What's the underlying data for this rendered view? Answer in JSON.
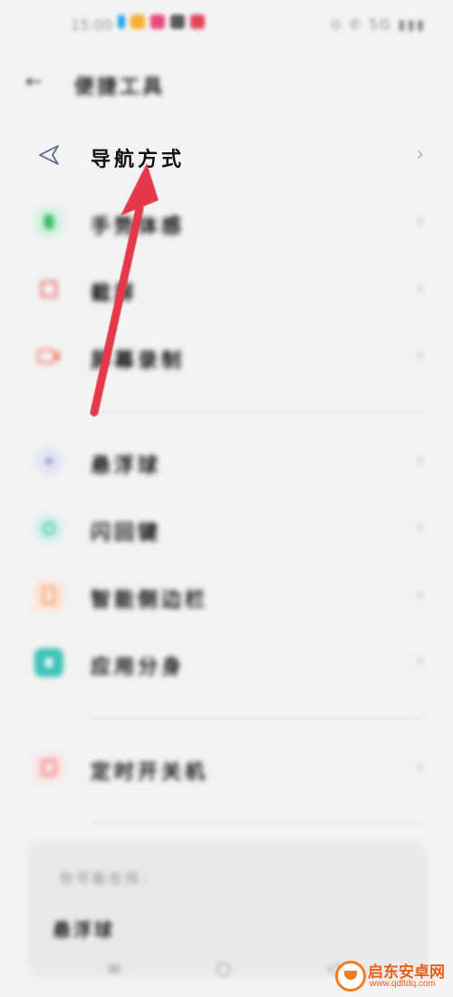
{
  "status_bar": {
    "time": "15:00",
    "right_icons": "⊙ ✆ 5G ▮▮▮"
  },
  "header": {
    "back_icon": "arrow-left-icon",
    "title": "便捷工具"
  },
  "list": {
    "items": [
      {
        "icon": "navigation-triangle-icon",
        "label": "导航方式",
        "color": "#5b6b8a"
      },
      {
        "icon": "hand-gesture-icon",
        "label": "手势体感",
        "color": "#3dbb6a"
      },
      {
        "icon": "screenshot-icon",
        "label": "截屏",
        "color": "#f06a6a"
      },
      {
        "icon": "screen-record-icon",
        "label": "屏幕录制",
        "color": "#f0806a"
      },
      {
        "icon": "floating-ball-icon",
        "label": "悬浮球",
        "color": "#8f97c9"
      },
      {
        "icon": "flash-notes-icon",
        "label": "闪回键",
        "color": "#3fbfa8"
      },
      {
        "icon": "smart-sidebar-icon",
        "label": "智能侧边栏",
        "color": "#f3a070"
      },
      {
        "icon": "app-clone-icon",
        "label": "应用分身",
        "color": "#3fc3b8"
      },
      {
        "icon": "timer-switch-icon",
        "label": "定时开关机",
        "color": "#f07a7a"
      }
    ]
  },
  "card": {
    "heading": "你可能在找：",
    "link": "悬浮球"
  },
  "navbar": {
    "menu": "≡",
    "home": "○",
    "back": "◁"
  },
  "watermark": {
    "brand": "启东安卓网",
    "url": "www.qdltdq.com"
  },
  "colors": {
    "background": "#f3f3f3",
    "arrow": "#e23848",
    "chevron": "#b5b5b5"
  }
}
